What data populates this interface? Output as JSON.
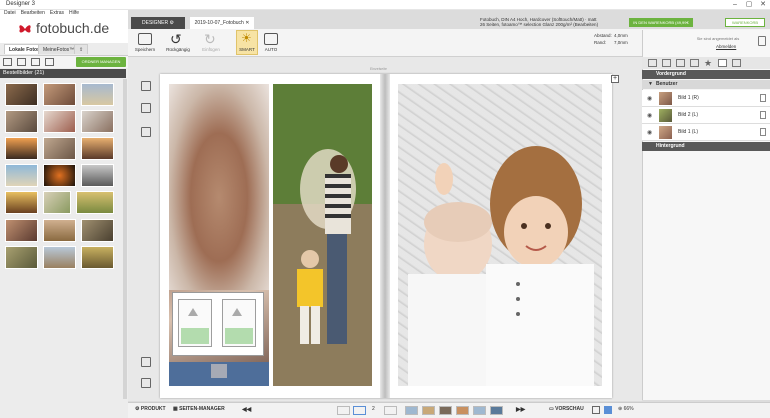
{
  "app": {
    "title": "Designer 3"
  },
  "menu": [
    "Datei",
    "Bearbeiten",
    "Extras",
    "Hilfe"
  ],
  "logo": {
    "text": "fotobuch.de"
  },
  "left_tabs": [
    "Lokale Fotos",
    "MeineFotos™"
  ],
  "manager_button": "ORDNER MANAGEN",
  "images_header": "Bestellbilder (21)",
  "doc_tabs": {
    "designer": "DESIGNER",
    "project": "2019-10-07_Fotobuch"
  },
  "toolbar": {
    "save": "Speichern",
    "undo": "Rückgängig",
    "redo": "Einfügen",
    "smart": "SMART",
    "auto": "AUTO"
  },
  "product_info": {
    "line1": "Fotobuch, DIN A4 Hoch, Hardcover (Softtouch/Matt) · matt",
    "line2": "26 Seiten, fotoamo™ selection Glanz 200g/m² (Bearbeiten)"
  },
  "cart_button": "IN DEN WARENKORB (49,99€ 55,99 €)",
  "cart_button2": "WARENKORB",
  "abstand": {
    "label": "Abstand:",
    "value": "4,0mm"
  },
  "rand": {
    "label": "Rand:",
    "value": "7,0mm"
  },
  "account": {
    "text": "Sie sind angemeldet als",
    "link": "Abmelden"
  },
  "book_label": "Einzelseite",
  "layers": {
    "vordergrund": "Vordergrund",
    "benutzer": "Benutzer",
    "items": [
      "Bild 1 (R)",
      "Bild 2 (L)",
      "Bild 1 (L)"
    ],
    "hintergrund": "Hintergrund"
  },
  "bottom": {
    "produkt": "PRODUKT",
    "seiten_manager": "SEITEN-MANAGER",
    "page_nums": "2",
    "vorschau": "VORSCHAU",
    "zoom": "66%"
  }
}
